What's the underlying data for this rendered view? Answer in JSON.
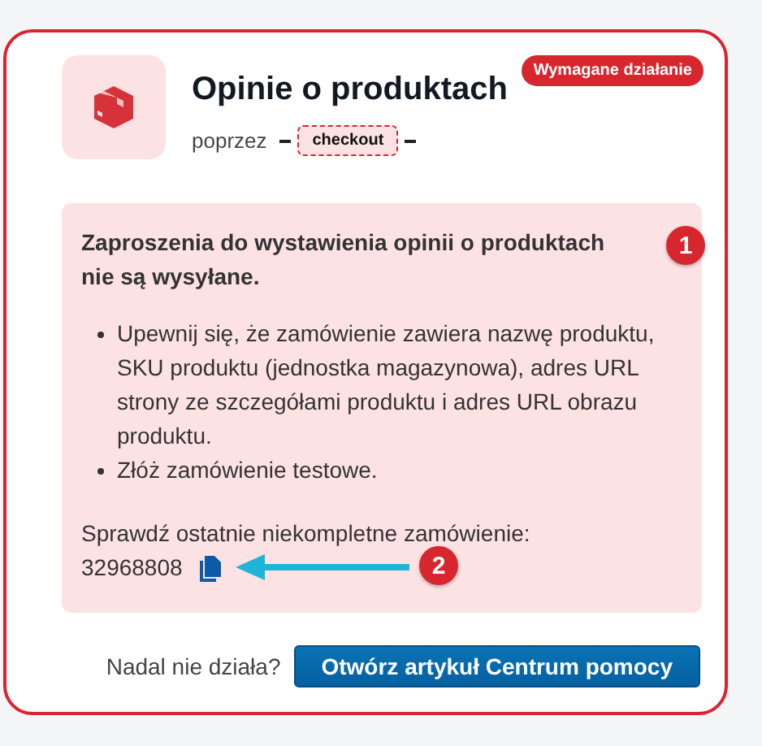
{
  "card": {
    "title": "Opinie o produktach",
    "badge": "Wymagane działanie",
    "source_label": "poprzez",
    "source_tag": "checkout"
  },
  "alert": {
    "heading": "Zaproszenia do wystawienia opinii o produktach nie są wysyłane.",
    "bullets": [
      "Upewnij się, że zamówienie zawiera nazwę produktu, SKU produktu (jednostka magazynowa), adres URL strony ze szczegółami produktu i adres URL obrazu produktu.",
      "Złóż zamówienie testowe."
    ],
    "check_label": "Sprawdź ostatnie niekompletne zamówienie:",
    "order_number": "32968808"
  },
  "annotations": [
    "1",
    "2"
  ],
  "footer": {
    "question": "Nadal nie działa?",
    "button": "Otwórz artykuł Centrum pomocy"
  }
}
